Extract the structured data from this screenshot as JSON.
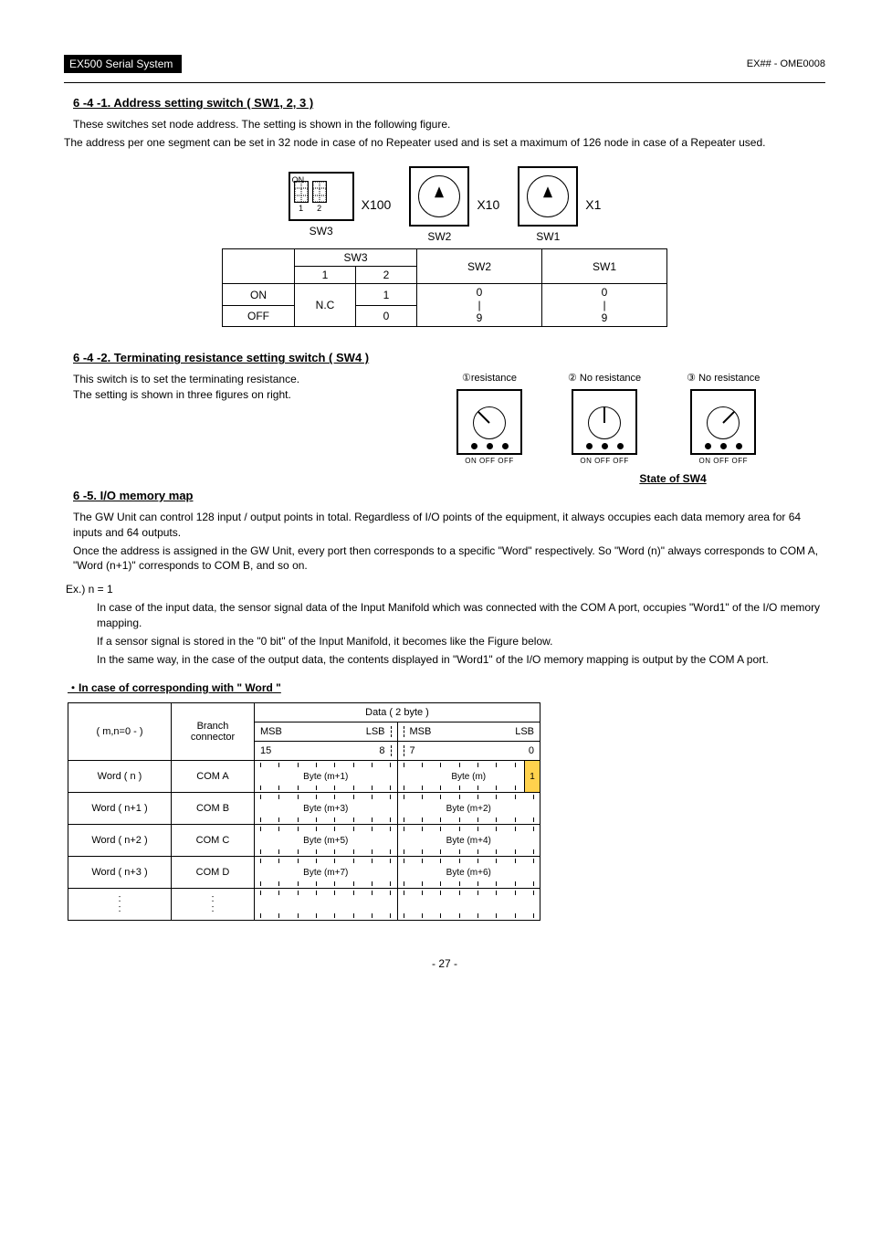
{
  "header": {
    "title_black": "EX500 Serial System",
    "right": "EX## - OME0008"
  },
  "s641": {
    "heading": "6 -4 -1. Address setting switch ( SW1, 2, 3 )",
    "p1": "These switches set node address. The setting is shown in the following figure.",
    "p2": "The address per one segment can be set in 32 node in case of no Repeater used and is set a maximum of 126 node in case of a Repeater used.",
    "sw3_on": "ON",
    "dip1": "1",
    "dip2": "2",
    "x100": "X100",
    "x10": "X10",
    "x1": "X1",
    "cap_sw3": "SW3",
    "cap_sw2": "SW2",
    "cap_sw1": "SW1"
  },
  "swTable": {
    "h_sw3": "SW3",
    "h_sw3_1": "1",
    "h_sw3_2": "2",
    "h_sw2": "SW2",
    "h_sw1": "SW1",
    "r_on": "ON",
    "r_off": "OFF",
    "nc": "N.C",
    "v_on_2": "1",
    "v_off_2": "0",
    "v_sw2": "0\n|\n9",
    "v_sw1": "0\n|\n9"
  },
  "s642": {
    "heading": "6 -4 -2. Terminating resistance setting switch ( SW4 )",
    "p1": "This switch is to set the terminating resistance.",
    "p2": "The setting is shown in three figures on right.",
    "f1": "①resistance",
    "f2": "② No  resistance",
    "f3": "③ No resistance",
    "bottom": "ON   OFF OFF",
    "state": "State of SW4"
  },
  "s65": {
    "heading": "6 -5. I/O memory map",
    "p1": "The GW Unit can control 128 input / output points in total. Regardless of I/O points of the equipment, it always occupies each data memory area for 64 inputs and 64 outputs.",
    "p2": "Once the address is assigned in the GW Unit, every port then corresponds to a specific \"Word\" respectively. So \"Word (n)\" always corresponds to COM A, \"Word (n+1)\" corresponds to COM B, and so on.",
    "ex_label": "Ex.) n = 1",
    "ex1": "In case of the input data, the sensor signal data of the Input Manifold which was connected with the COM A port, occupies \"Word1\" of the I/O memory mapping.",
    "ex2": "If a sensor signal is stored in the \"0 bit\" of the Input Manifold, it becomes like the Figure below.",
    "ex3": "In the same way, in the case of the output data, the contents displayed in \"Word1\" of the I/O memory mapping is output by the COM A port.",
    "caption": "・In case of corresponding with \" Word \""
  },
  "memTable": {
    "mn": "( m,n=0 - )",
    "branch": "Branch connector",
    "data": "Data ( 2 byte )",
    "msb1": "MSB",
    "lsb1": "LSB",
    "msb2": "MSB",
    "lsb2": "LSB",
    "b15": "15",
    "b8": "8",
    "b7": "7",
    "b0": "0",
    "rows": [
      {
        "w": "Word ( n )",
        "c": "COM A",
        "hi": "Byte (m+1)",
        "lo": "Byte (m)",
        "mark": true
      },
      {
        "w": "Word ( n+1 )",
        "c": "COM B",
        "hi": "Byte (m+3)",
        "lo": "Byte (m+2)",
        "mark": false
      },
      {
        "w": "Word ( n+2 )",
        "c": "COM C",
        "hi": "Byte (m+5)",
        "lo": "Byte (m+4)",
        "mark": false
      },
      {
        "w": "Word ( n+3 )",
        "c": "COM D",
        "hi": "Byte (m+7)",
        "lo": "Byte (m+6)",
        "mark": false
      }
    ],
    "dots": ":",
    "bit1": "1"
  },
  "footer": "- 27 -"
}
